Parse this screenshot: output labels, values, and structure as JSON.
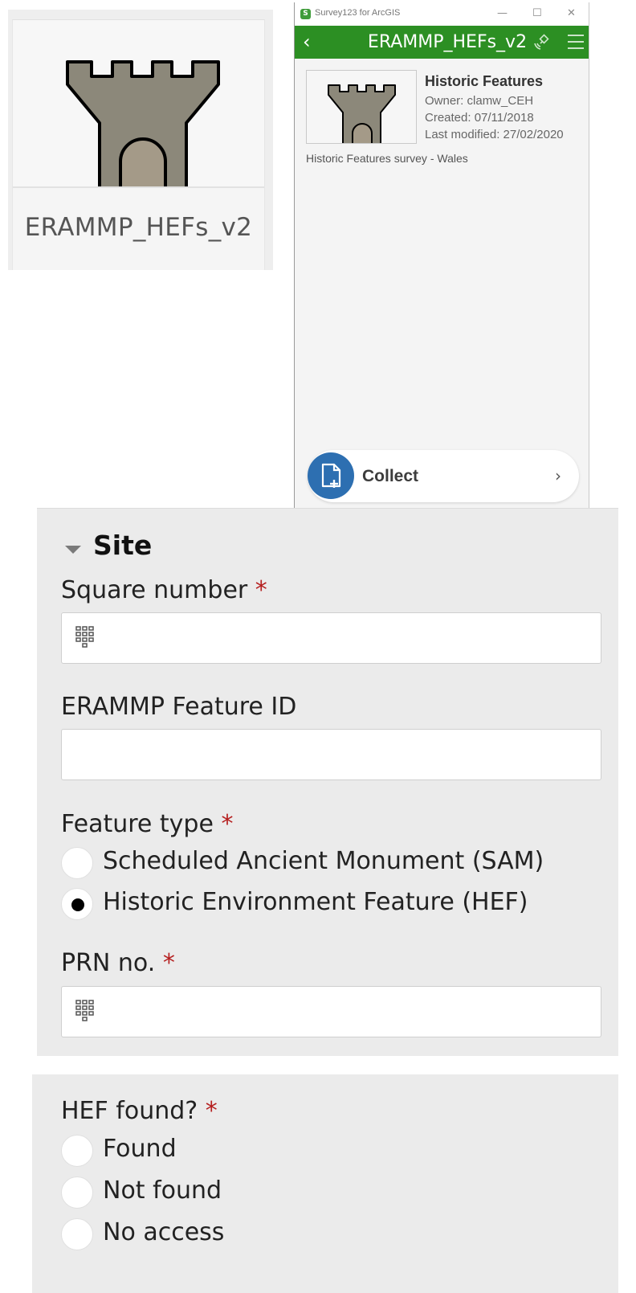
{
  "tile": {
    "title": "ERAMMP_HEFs_v2",
    "thumbnail_icon": "castle-tower-icon"
  },
  "window": {
    "app_name": "Survey123 for ArcGIS",
    "minimize_glyph": "—",
    "maximize_glyph": "☐",
    "close_glyph": "✕",
    "back_glyph": "‹",
    "title": "ERAMMP_HEFs_v2",
    "gps_icon": "gps-signal-icon",
    "menu_icon": "hamburger-menu-icon",
    "accent_color": "#2c8f23"
  },
  "survey_info": {
    "title": "Historic Features",
    "owner": "Owner: clamw_CEH",
    "created": "Created: 07/11/2018",
    "modified": "Last modified: 27/02/2020",
    "description": "Historic Features survey - Wales"
  },
  "collect": {
    "label": "Collect",
    "icon": "new-document-icon",
    "chevron": "›",
    "color": "#2d6fb1"
  },
  "site": {
    "title": "Site",
    "square_number": {
      "label": "Square number ",
      "required": "*",
      "value": "",
      "icon": "numeric-keypad-icon"
    },
    "feature_id": {
      "label": "ERAMMP Feature ID",
      "value": ""
    },
    "feature_type": {
      "label": "Feature type ",
      "required": "*",
      "options": [
        {
          "label": "Scheduled Ancient Monument (SAM)",
          "selected": false
        },
        {
          "label": "Historic Environment Feature (HEF)",
          "selected": true
        }
      ]
    },
    "prn": {
      "label": "PRN no. ",
      "required": "*",
      "value": "",
      "icon": "numeric-keypad-icon"
    }
  },
  "hef_found": {
    "label": "HEF found? ",
    "required": "*",
    "options": [
      {
        "label": "Found",
        "selected": false
      },
      {
        "label": "Not found",
        "selected": false
      },
      {
        "label": "No access",
        "selected": false
      }
    ]
  }
}
